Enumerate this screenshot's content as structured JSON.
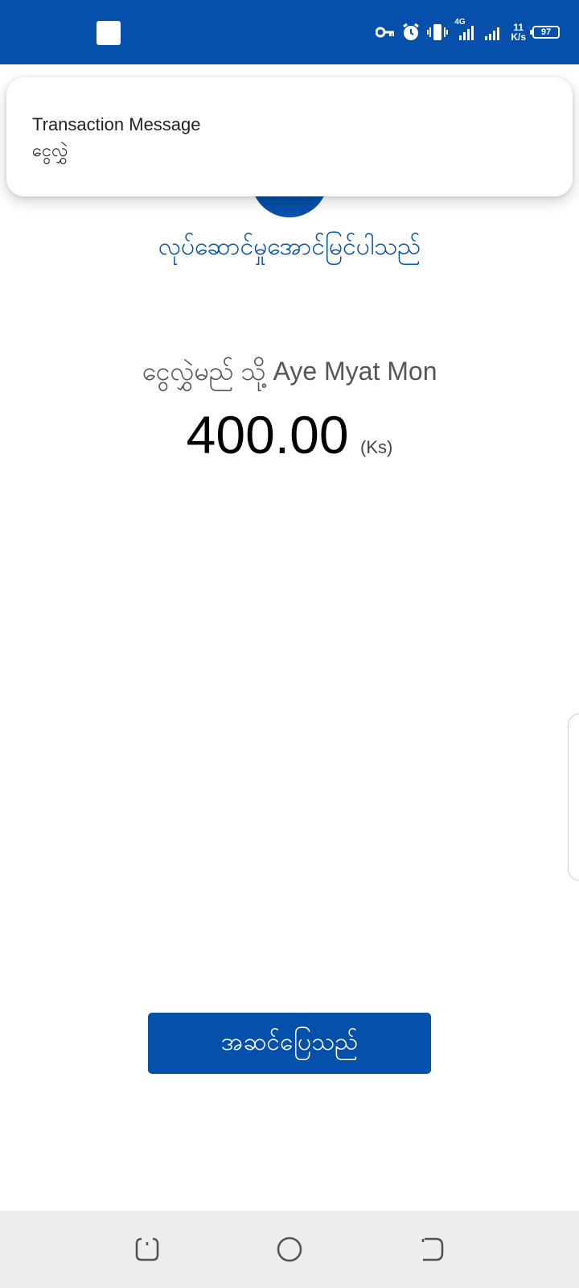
{
  "status_bar": {
    "network_type": "4G",
    "speed_value": "11",
    "speed_unit": "K/s",
    "battery_level": "97",
    "icons": [
      "key-icon",
      "alarm-icon",
      "vibrate-icon",
      "signal-icon",
      "signal-icon",
      "battery-icon"
    ],
    "background_color": "#0550ab"
  },
  "notification": {
    "title": "Transaction Message",
    "body": "ငွေလွှဲ"
  },
  "result": {
    "success_text": "လုပ်ဆောင်မှုအောင်မြင်ပါသည်",
    "recipient_text": "ငွေလွှဲမည် သို့ Aye Myat Mon",
    "amount": "400.00",
    "currency": "(Ks)"
  },
  "actions": {
    "done_label": "အဆင်ပြေသည်"
  },
  "nav_bar": {
    "icons": [
      "recent-apps-icon",
      "home-icon",
      "back-icon"
    ]
  },
  "colors": {
    "accent": "#0550ab",
    "text_primary": "#000000",
    "text_secondary": "#555555",
    "background": "#ffffff",
    "nav_background": "#eeeeee"
  }
}
